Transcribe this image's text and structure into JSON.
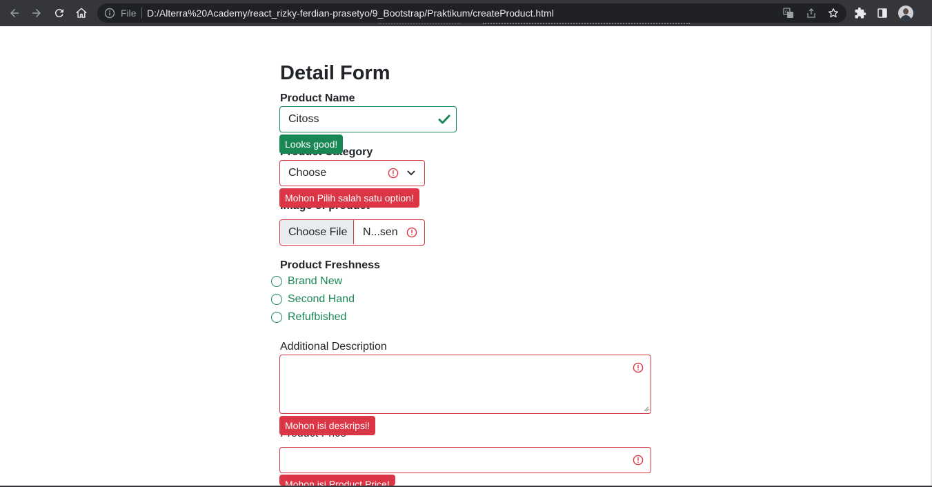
{
  "browser": {
    "scheme_label": "File",
    "url": "D:/Alterra%20Academy/react_rizky-ferdian-prasetyo/9_Bootstrap/Praktikum/createProduct.html",
    "icons": [
      "back-icon",
      "forward-icon",
      "reload-icon",
      "home-icon",
      "info-icon",
      "translate-icon",
      "share-icon",
      "star-icon",
      "extensions-icon",
      "side-panel-icon",
      "profile-avatar"
    ]
  },
  "form": {
    "title": "Detail Form",
    "product_name": {
      "label": "Product Name",
      "value": "Citoss",
      "feedback": "Looks good!"
    },
    "product_category": {
      "label": "Product Category",
      "selected": "Choose",
      "feedback": "Mohon Pilih salah satu option!"
    },
    "product_image": {
      "label": "Image of product",
      "button": "Choose File",
      "file_status": "N...sen"
    },
    "product_freshness": {
      "label": "Product Freshness",
      "options": [
        "Brand New",
        "Second Hand",
        "Refufbished"
      ]
    },
    "additional_description": {
      "label": "Additional Description",
      "value": "",
      "feedback": "Mohon isi deskripsi!"
    },
    "product_price": {
      "label": "Product Price",
      "value": "",
      "feedback": "Mohon isi Product Price!"
    }
  },
  "colors": {
    "valid": "#198754",
    "invalid": "#dc3545",
    "chrome": "#35363a",
    "omnibox": "#202124"
  }
}
